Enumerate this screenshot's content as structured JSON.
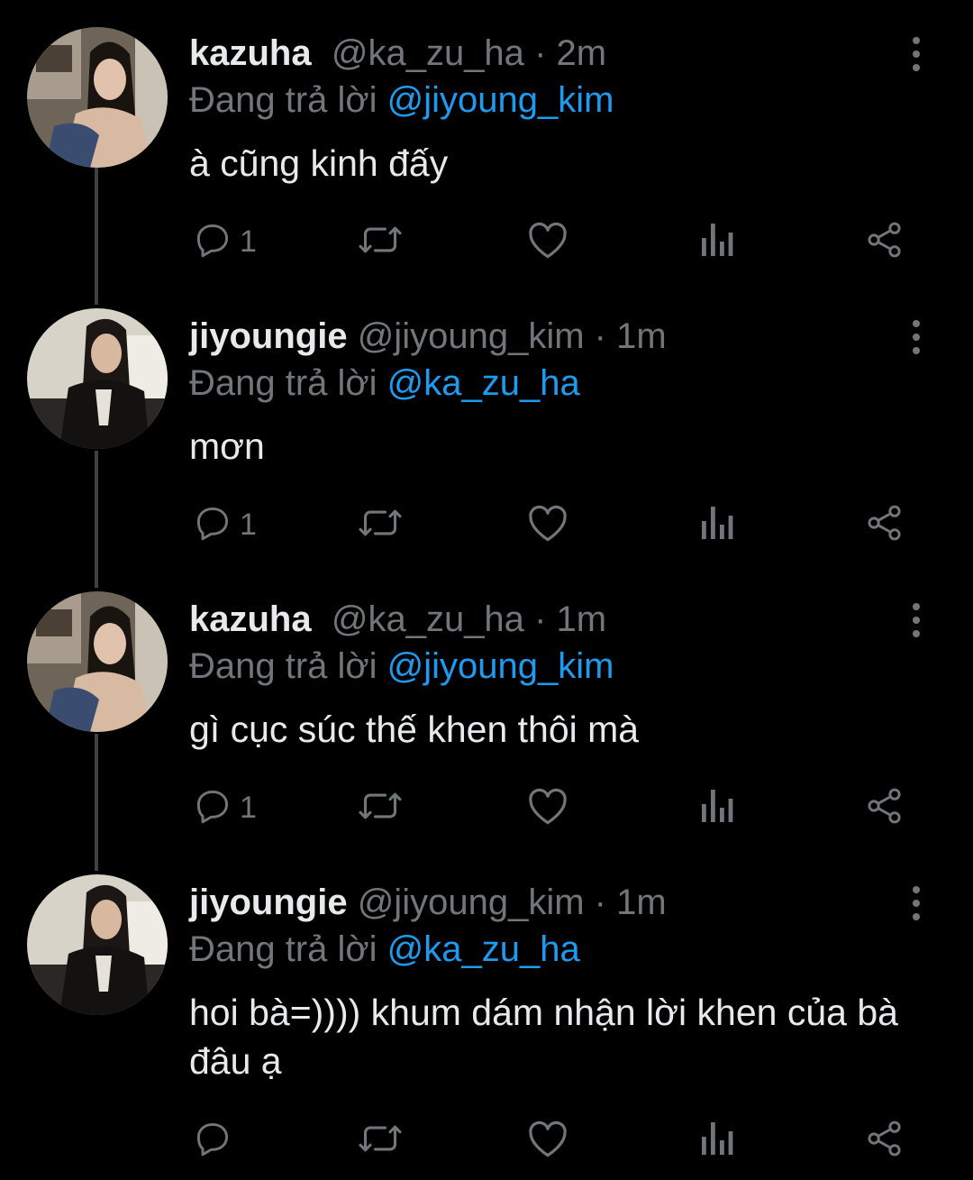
{
  "colors": {
    "background": "#000000",
    "text": "#e7e9ea",
    "muted": "#71767b",
    "mention": "#1d9bf0",
    "thread_line": "#3e4144"
  },
  "reply_prefix": "Đang trả lời",
  "tweets": [
    {
      "display_name": "kazuha",
      "handle": "@ka_zu_ha",
      "separator": "·",
      "time": "2m",
      "reply_to": "@jiyoung_kim",
      "text": "à cũng kinh đấy",
      "reply_count": "1",
      "avatar": "kazuha-avatar"
    },
    {
      "display_name": "jiyoungie",
      "handle": "@jiyoung_kim",
      "separator": "·",
      "time": "1m",
      "reply_to": "@ka_zu_ha",
      "text": "mơn",
      "reply_count": "1",
      "avatar": "jiyoungie-avatar"
    },
    {
      "display_name": "kazuha",
      "handle": "@ka_zu_ha",
      "separator": "·",
      "time": "1m",
      "reply_to": "@jiyoung_kim",
      "text": "gì cục súc thế khen thôi mà",
      "reply_count": "1",
      "avatar": "kazuha-avatar"
    },
    {
      "display_name": "jiyoungie",
      "handle": "@jiyoung_kim",
      "separator": "·",
      "time": "1m",
      "reply_to": "@ka_zu_ha",
      "text": "hoi bà=)))) khum dám nhận lời khen của bà đâu ạ",
      "reply_count": "",
      "avatar": "jiyoungie-avatar"
    }
  ],
  "icons": {
    "more": "more-vertical-icon",
    "reply": "reply-icon",
    "retweet": "retweet-icon",
    "like": "heart-icon",
    "views": "views-icon",
    "share": "share-icon"
  }
}
